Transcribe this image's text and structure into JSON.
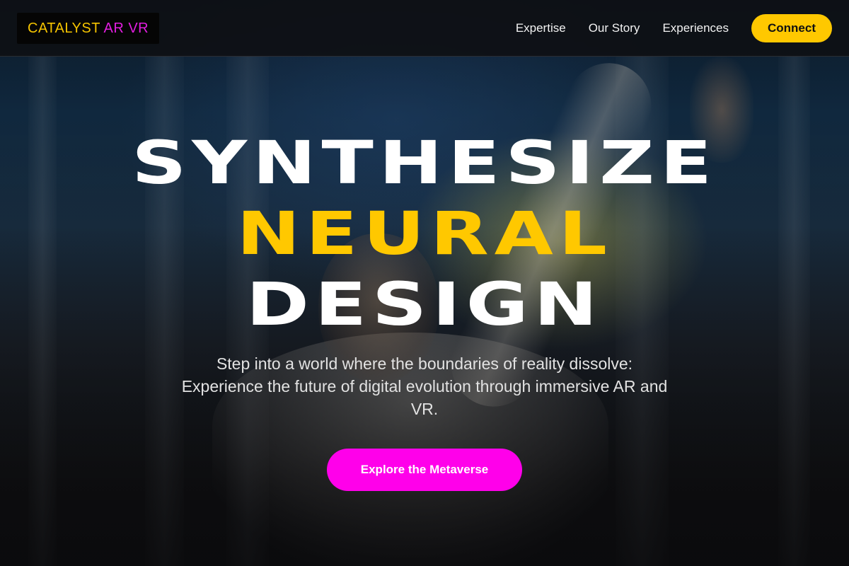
{
  "brand": {
    "logo_part1": "CATALYST",
    "logo_part2": "AR VR"
  },
  "nav": {
    "items": [
      {
        "label": "Expertise"
      },
      {
        "label": "Our Story"
      },
      {
        "label": "Experiences"
      }
    ],
    "connect_label": "Connect"
  },
  "hero": {
    "headline_line1": "SYNTHESIZE",
    "headline_line2": "NEURAL",
    "headline_line3": "DESIGN",
    "subtitle": "Step into a world where the boundaries of reality dissolve: Experience the future of digital evolution through immersive AR and VR.",
    "cta_label": "Explore the Metaverse"
  },
  "colors": {
    "accent_yellow": "#ffc800",
    "accent_magenta": "#ff00ea",
    "header_bg": "#0e1014"
  }
}
